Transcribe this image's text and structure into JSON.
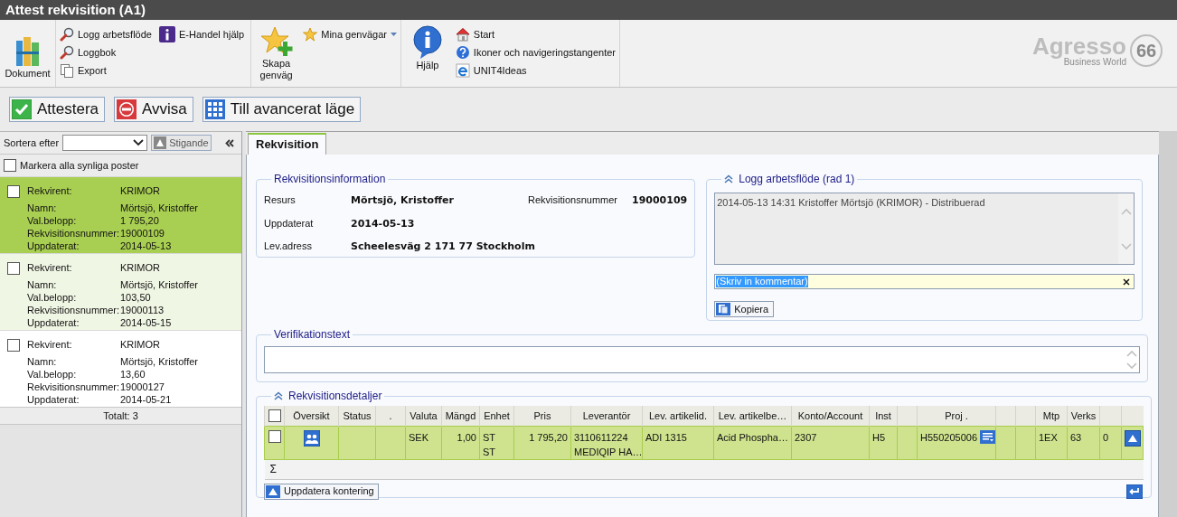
{
  "window": {
    "title": "Attest rekvisition (A1)"
  },
  "toolbar": {
    "groups": [
      {
        "items": [
          {
            "kind": "large",
            "label": "Dokument"
          }
        ]
      },
      {
        "items": [
          {
            "kind": "small",
            "label": "Logg arbetsflöde"
          },
          {
            "kind": "small",
            "label": "Loggbok"
          },
          {
            "kind": "small",
            "label": "Export"
          },
          {
            "kind": "small",
            "label": "E-Handel hjälp"
          }
        ]
      },
      {
        "items": [
          {
            "kind": "large",
            "label": "Skapa genväg"
          },
          {
            "kind": "menu",
            "label": "Mina genvägar"
          }
        ]
      },
      {
        "items": [
          {
            "kind": "large",
            "label": "Hjälp"
          },
          {
            "kind": "small",
            "label": "Start"
          },
          {
            "kind": "small",
            "label": "Ikoner och navigeringstangenter"
          },
          {
            "kind": "small",
            "label": "UNIT4Ideas"
          }
        ]
      }
    ]
  },
  "logo": {
    "name": "Agresso",
    "tagline": "Business World",
    "badge": "66"
  },
  "actions": [
    {
      "label": "Attestera"
    },
    {
      "label": "Avvisa"
    },
    {
      "label": "Till avancerat läge"
    }
  ],
  "list": {
    "sort_label": "Sortera efter",
    "sort_order": "Stigande",
    "select_all": {
      "label": "Markera alla synliga poster",
      "checked": false
    },
    "items": [
      {
        "selected": true,
        "checked": false,
        "fields": [
          {
            "label": "Rekvirent:",
            "value": "KRIMOR"
          },
          {
            "label": "Namn:",
            "value": "Mörtsjö, Kristoffer"
          },
          {
            "label": "Val.belopp:",
            "value": "1 795,20"
          },
          {
            "label": "Rekvisitionsnummer:",
            "value": "19000109"
          },
          {
            "label": "Uppdaterat:",
            "value": "2014-05-13"
          }
        ]
      },
      {
        "selected": false,
        "checked": false,
        "fields": [
          {
            "label": "Rekvirent:",
            "value": "KRIMOR"
          },
          {
            "label": "Namn:",
            "value": "Mörtsjö, Kristoffer"
          },
          {
            "label": "Val.belopp:",
            "value": "103,50"
          },
          {
            "label": "Rekvisitionsnummer:",
            "value": "19000113"
          },
          {
            "label": "Uppdaterat:",
            "value": "2014-05-15"
          }
        ]
      },
      {
        "selected": false,
        "checked": false,
        "fields": [
          {
            "label": "Rekvirent:",
            "value": "KRIMOR"
          },
          {
            "label": "Namn:",
            "value": "Mörtsjö, Kristoffer"
          },
          {
            "label": "Val.belopp:",
            "value": "13,60"
          },
          {
            "label": "Rekvisitionsnummer:",
            "value": "19000127"
          },
          {
            "label": "Uppdaterat:",
            "value": "2014-05-21"
          }
        ]
      }
    ],
    "total": "Totalt: 3"
  },
  "tabs": [
    {
      "label": "Rekvisition",
      "selected": true
    }
  ],
  "info": {
    "title": "Rekvisitionsinformation",
    "fields": [
      {
        "label": "Resurs",
        "value": "Mörtsjö, Kristoffer"
      },
      {
        "label": "Rekvisitionsnummer",
        "value": "19000109"
      },
      {
        "label": "Uppdaterat",
        "value": "2014-05-13"
      },
      {
        "label": "Lev.adress",
        "value": "Scheelesväg 2 171 77 Stockholm"
      }
    ]
  },
  "log": {
    "title": "Logg arbetsflöde (rad 1)",
    "expanded": true,
    "entries": [
      "2014-05-13 14:31 Kristoffer Mörtsjö (KRIMOR) - Distribuerad"
    ],
    "comment": {
      "value": "(Skriv in kommentar)",
      "text_selected": true
    },
    "copy_button": "Kopiera"
  },
  "verification": {
    "title": "Verifikationstext"
  },
  "details": {
    "title": "Rekvisitionsdetaljer",
    "expanded": true,
    "columns": [
      {
        "kind": "checkbox",
        "checked": false
      },
      {
        "label": "Översikt"
      },
      {
        "label": "Status"
      },
      {
        "label": "."
      },
      {
        "label": "Valuta"
      },
      {
        "label": "Mängd"
      },
      {
        "label": "Enhet"
      },
      {
        "label": "Pris"
      },
      {
        "label": "Leverantör"
      },
      {
        "label": "Lev. artikelid."
      },
      {
        "label": "Lev. artikelbe…"
      },
      {
        "label": "Konto/Account"
      },
      {
        "label": "Inst"
      },
      {},
      {
        "label": "Proj ."
      },
      {},
      {},
      {
        "label": "Mtp"
      },
      {
        "label": "Verks"
      },
      {},
      {}
    ],
    "rows": [
      {
        "selected": true,
        "cells": [
          {
            "kind": "checkbox",
            "checked": false
          },
          {
            "kind": "icon"
          },
          {
            "kind": "empty"
          },
          {
            "kind": "empty"
          },
          {
            "kind": "text",
            "lines": [
              "SEK"
            ]
          },
          {
            "kind": "number",
            "lines": [
              "1,00"
            ]
          },
          {
            "kind": "text",
            "lines": [
              "ST",
              "ST"
            ]
          },
          {
            "kind": "number",
            "lines": [
              "1 795,20"
            ]
          },
          {
            "kind": "text",
            "lines": [
              "3110611224",
              "MEDIQIP HA…"
            ]
          },
          {
            "kind": "text",
            "lines": [
              "ADI 1315"
            ]
          },
          {
            "kind": "text",
            "lines": [
              "Acid Phospha…"
            ]
          },
          {
            "kind": "text",
            "lines": [
              "2307"
            ]
          },
          {
            "kind": "text",
            "lines": [
              "H5"
            ]
          },
          {
            "kind": "empty"
          },
          {
            "kind": "lookup",
            "lines": [
              "H550205006"
            ]
          },
          {
            "kind": "empty"
          },
          {
            "kind": "empty"
          },
          {
            "kind": "text",
            "lines": [
              "1EX"
            ]
          },
          {
            "kind": "text",
            "lines": [
              "63"
            ]
          },
          {
            "kind": "text",
            "lines": [
              "0"
            ]
          },
          {
            "kind": "button"
          }
        ]
      }
    ],
    "sum_symbol": "Σ",
    "update_button": "Uppdatera kontering"
  }
}
